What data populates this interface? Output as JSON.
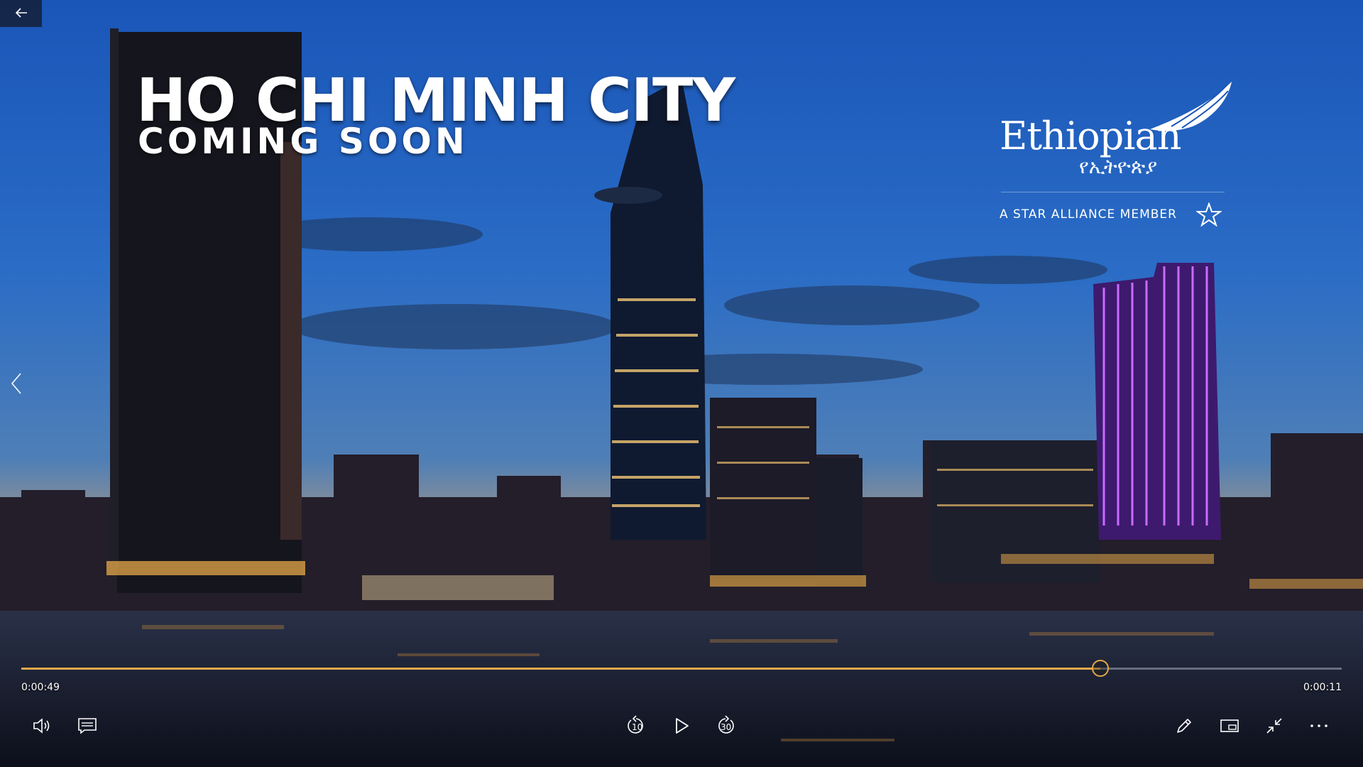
{
  "video": {
    "title_line1": "HO CHI MINH CITY",
    "title_line2": "COMING SOON"
  },
  "brand": {
    "name": "Ethiopian",
    "name_amharic": "የኢትዮጵያ",
    "alliance": "A STAR ALLIANCE MEMBER"
  },
  "player": {
    "elapsed": "0:00:49",
    "remaining": "0:00:11",
    "progress": 0.817,
    "skip_back_seconds": "10",
    "skip_forward_seconds": "30",
    "accent_color": "#e3a94a"
  },
  "icons": {
    "back": "arrow-left-icon",
    "prev": "chevron-left-icon",
    "volume": "volume-icon",
    "subtitles": "subtitles-icon",
    "skip_back": "skip-back-10-icon",
    "play": "play-icon",
    "skip_forward": "skip-forward-30-icon",
    "edit": "pencil-icon",
    "mini_view": "mini-view-icon",
    "exit_fullscreen": "exit-fullscreen-icon",
    "more": "more-options-icon"
  }
}
